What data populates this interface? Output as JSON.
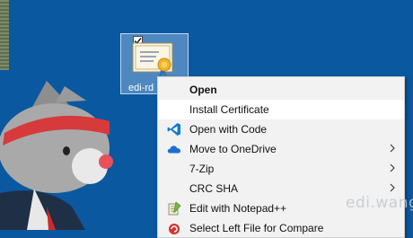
{
  "desktop": {
    "icon_label": "edi-rd",
    "icon_name": "certificate-file-icon"
  },
  "context_menu": {
    "items": [
      {
        "label": "Open",
        "icon": "",
        "submenu": false,
        "bold": true
      },
      {
        "label": "Install Certificate",
        "icon": "",
        "submenu": false,
        "highlight": true
      },
      {
        "label": "Open with Code",
        "icon": "vscode-icon",
        "submenu": false
      },
      {
        "label": "Move to OneDrive",
        "icon": "onedrive-icon",
        "submenu": true
      },
      {
        "label": "7-Zip",
        "icon": "",
        "submenu": true
      },
      {
        "label": "CRC SHA",
        "icon": "",
        "submenu": true
      },
      {
        "label": "Edit with Notepad++",
        "icon": "notepadpp-icon",
        "submenu": false
      },
      {
        "label": "Select Left File for Compare",
        "icon": "compare-icon",
        "submenu": false
      }
    ]
  },
  "watermark": "edi.wang",
  "colors": {
    "desktop_bg": "#0a58a0",
    "menu_bg": "#f2f2f2",
    "menu_highlight": "#ffffff"
  }
}
